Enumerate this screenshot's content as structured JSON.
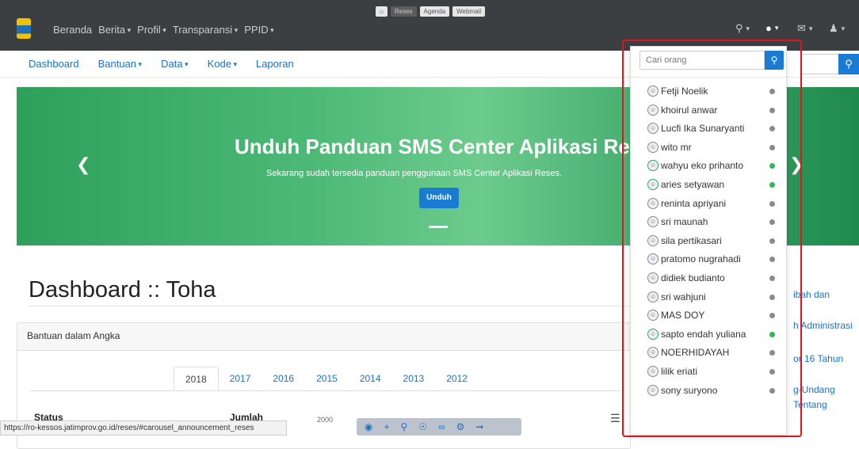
{
  "topbar": {
    "nav": [
      {
        "label": "Beranda",
        "caret": false
      },
      {
        "label": "Berita",
        "caret": true
      },
      {
        "label": "Profil",
        "caret": true
      },
      {
        "label": "Transparansi",
        "caret": true
      },
      {
        "label": "PPID",
        "caret": true
      }
    ],
    "quicknav": [
      "Reses",
      "Agenda",
      "Webmail"
    ]
  },
  "subnav": [
    "Dashboard",
    "Bantuan",
    "Data",
    "Kode",
    "Laporan"
  ],
  "banner": {
    "title": "Unduh Panduan SMS Center Aplikasi Reses",
    "subtitle": "Sekarang sudah tersedia panduan penggunaan SMS Center Aplikasi Reses.",
    "button": "Unduh"
  },
  "dashboard": {
    "title": "Dashboard :: Toha",
    "card_title": "Bantuan dalam Angka",
    "years": [
      "2018",
      "2017",
      "2016",
      "2015",
      "2014",
      "2013",
      "2012"
    ],
    "col_status": "Status",
    "col_jumlah": "Jumlah",
    "tick": "2000"
  },
  "side_links": [
    "ibah dan",
    "h Administrasi",
    "or 16 Tahun",
    "g-Undang",
    "Tentang"
  ],
  "statusbar": "https://ro-kessos.jatimprov.go.id/reses/#carousel_announcement_reses",
  "people_dropdown": {
    "placeholder": "Cari orang",
    "people": [
      {
        "name": "Fetji Noelik",
        "online": false
      },
      {
        "name": "khoirul anwar",
        "online": false
      },
      {
        "name": "Lucfi Ika Sunaryanti",
        "online": false
      },
      {
        "name": "wito mr",
        "online": false
      },
      {
        "name": "wahyu eko prihanto",
        "online": true
      },
      {
        "name": "aries setyawan",
        "online": true
      },
      {
        "name": "reninta apriyani",
        "online": false
      },
      {
        "name": "sri maunah",
        "online": false
      },
      {
        "name": "sila pertikasari",
        "online": false
      },
      {
        "name": "pratomo nugrahadi",
        "online": false
      },
      {
        "name": "didiek budianto",
        "online": false
      },
      {
        "name": "sri wahjuni",
        "online": false
      },
      {
        "name": "MAS DOY",
        "online": false
      },
      {
        "name": "sapto endah yuliana",
        "online": true
      },
      {
        "name": "NOERHIDAYAH",
        "online": false
      },
      {
        "name": "lilik eriati",
        "online": false
      },
      {
        "name": "sony suryono",
        "online": false
      }
    ]
  }
}
